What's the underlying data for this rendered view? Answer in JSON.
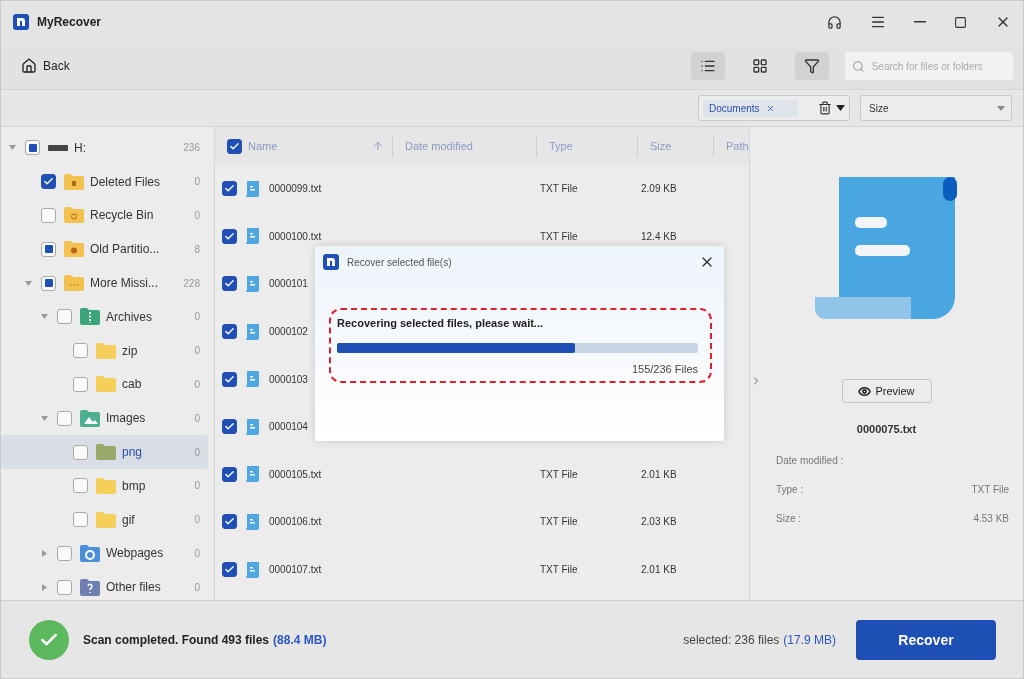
{
  "window": {
    "title": "MyRecover"
  },
  "toolbar": {
    "back": "Back",
    "views": [
      {
        "kind": "list",
        "selected": true
      },
      {
        "kind": "grid",
        "selected": false
      },
      {
        "kind": "filter",
        "selected": true
      }
    ],
    "search": {
      "placeholder": "Search for files or folders"
    }
  },
  "filter_bar": {
    "chips": [
      "Documents"
    ],
    "sort": "Size"
  },
  "tree": [
    {
      "label": "H:",
      "count": "236",
      "kind": "drive",
      "checked": false,
      "partial": true,
      "expanded": true,
      "selected": false,
      "children": [
        {
          "label": "Deleted Files",
          "count": "0",
          "kind": "trash-folder",
          "checked": true,
          "partial": false,
          "selected": false
        },
        {
          "label": "Recycle Bin",
          "count": "0",
          "kind": "recycle-folder",
          "checked": false,
          "partial": false,
          "selected": false
        },
        {
          "label": "Old Partitio...",
          "count": "8",
          "kind": "clock-folder",
          "checked": false,
          "partial": true,
          "selected": false
        },
        {
          "label": "More Missi...",
          "count": "228",
          "kind": "dots-folder",
          "checked": false,
          "partial": true,
          "expanded": true,
          "selected": false,
          "children": [
            {
              "label": "Archives",
              "count": "0",
              "kind": "archive",
              "checked": false,
              "partial": false,
              "expanded": true,
              "selected": false,
              "children": [
                {
                  "label": "zip",
                  "count": "0",
                  "kind": "folder",
                  "checked": false,
                  "partial": false,
                  "selected": false
                },
                {
                  "label": "cab",
                  "count": "0",
                  "kind": "folder",
                  "checked": false,
                  "partial": false,
                  "selected": false
                }
              ]
            },
            {
              "label": "Images",
              "count": "0",
              "kind": "image",
              "checked": false,
              "partial": false,
              "expanded": true,
              "selected": false,
              "children": [
                {
                  "label": "png",
                  "count": "0",
                  "kind": "image-folder",
                  "checked": false,
                  "partial": false,
                  "selected": true
                },
                {
                  "label": "bmp",
                  "count": "0",
                  "kind": "folder",
                  "checked": false,
                  "partial": false,
                  "selected": false
                },
                {
                  "label": "gif",
                  "count": "0",
                  "kind": "folder",
                  "checked": false,
                  "partial": false,
                  "selected": false
                }
              ]
            },
            {
              "label": "Webpages",
              "count": "0",
              "kind": "web",
              "checked": false,
              "partial": false,
              "expanded": false,
              "selected": false
            },
            {
              "label": "Other files",
              "count": "0",
              "kind": "unknown",
              "checked": false,
              "partial": false,
              "expanded": false,
              "selected": false
            }
          ]
        }
      ]
    }
  ],
  "table": {
    "all_checked": true,
    "columns": [
      "Name",
      "Date modified",
      "Type",
      "Size",
      "Path"
    ],
    "rows": [
      {
        "name": "0000099.txt",
        "type": "TXT File",
        "size": "2.09 KB",
        "checked": true
      },
      {
        "name": "0000100.txt",
        "type": "TXT File",
        "size": "12.4 KB",
        "checked": true
      },
      {
        "name": "0000101",
        "checked": true
      },
      {
        "name": "0000102",
        "checked": true
      },
      {
        "name": "0000103",
        "checked": true
      },
      {
        "name": "0000104",
        "checked": true
      },
      {
        "name": "0000105.txt",
        "type": "TXT File",
        "size": "2.01 KB",
        "checked": true
      },
      {
        "name": "0000106.txt",
        "type": "TXT File",
        "size": "2.03 KB",
        "checked": true
      },
      {
        "name": "0000107.txt",
        "type": "TXT File",
        "size": "2.01 KB",
        "checked": true
      }
    ]
  },
  "dialog": {
    "title": "Recover selected file(s)",
    "message": "Recovering selected files, please wait...",
    "level": 0.66,
    "progress": "155/236 Files"
  },
  "preview": {
    "button": "Preview",
    "file": "0000075.txt",
    "details": [
      {
        "label": "Date modified :"
      },
      {
        "label": "Type :",
        "value": "TXT File"
      },
      {
        "label": "Size :",
        "value": "4.53 KB"
      }
    ]
  },
  "status_bar": {
    "summary": "Scan completed. Found 493 files",
    "summary_size": "(88.4 MB)",
    "selected": "selected: 236 files",
    "selected_size": "(17.9 MB)",
    "action": "Recover"
  }
}
